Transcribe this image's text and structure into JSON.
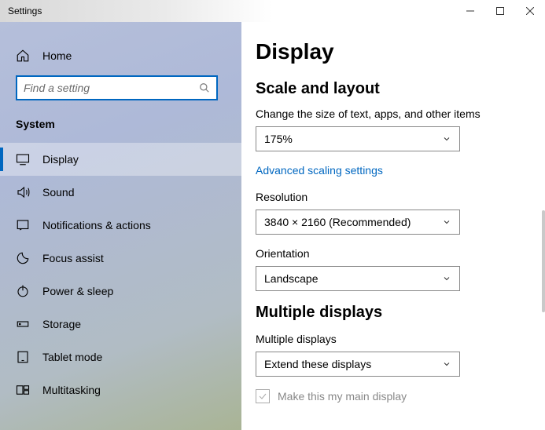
{
  "window": {
    "title": "Settings"
  },
  "sidebar": {
    "home_label": "Home",
    "search_placeholder": "Find a setting",
    "category_label": "System",
    "items": [
      {
        "label": "Display",
        "selected": true
      },
      {
        "label": "Sound"
      },
      {
        "label": "Notifications & actions"
      },
      {
        "label": "Focus assist"
      },
      {
        "label": "Power & sleep"
      },
      {
        "label": "Storage"
      },
      {
        "label": "Tablet mode"
      },
      {
        "label": "Multitasking"
      }
    ]
  },
  "main": {
    "page_title": "Display",
    "section1_title": "Scale and layout",
    "scale_label": "Change the size of text, apps, and other items",
    "scale_value": "175%",
    "advanced_link": "Advanced scaling settings",
    "resolution_label": "Resolution",
    "resolution_value": "3840 × 2160 (Recommended)",
    "orientation_label": "Orientation",
    "orientation_value": "Landscape",
    "section2_title": "Multiple displays",
    "multi_label": "Multiple displays",
    "multi_value": "Extend these displays",
    "main_display_label": "Make this my main display"
  }
}
